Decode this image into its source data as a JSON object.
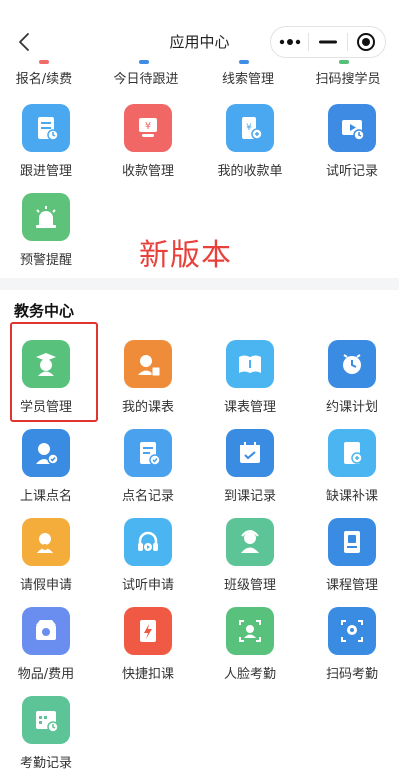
{
  "header": {
    "title": "应用中心"
  },
  "partial_row": {
    "items": [
      "报名/续费",
      "今日待跟进",
      "线索管理",
      "扫码搜学员"
    ],
    "stub_colors": [
      "#f26b6b",
      "#3f8de6",
      "#3f8de6",
      "#57c07a"
    ]
  },
  "sales": {
    "items": [
      {
        "label": "跟进管理",
        "icon": "follow-up-icon",
        "color": "#4aa8f0"
      },
      {
        "label": "收款管理",
        "icon": "payment-icon",
        "color": "#f06766"
      },
      {
        "label": "我的收款单",
        "icon": "receipt-icon",
        "color": "#4aa8f0"
      },
      {
        "label": "试听记录",
        "icon": "trial-record-icon",
        "color": "#3d8be3"
      },
      {
        "label": "预警提醒",
        "icon": "alarm-icon",
        "color": "#5fc27a"
      }
    ]
  },
  "annotation": {
    "text": "新版本"
  },
  "academic": {
    "title": "教务中心",
    "items": [
      {
        "label": "学员管理",
        "icon": "student-icon",
        "color": "#58c27d"
      },
      {
        "label": "我的课表",
        "icon": "my-schedule-icon",
        "color": "#ee8c3a"
      },
      {
        "label": "课表管理",
        "icon": "schedule-manage-icon",
        "color": "#4ab5f0"
      },
      {
        "label": "约课计划",
        "icon": "booking-plan-icon",
        "color": "#3a8be2"
      },
      {
        "label": "上课点名",
        "icon": "roll-call-icon",
        "color": "#3a8be2"
      },
      {
        "label": "点名记录",
        "icon": "roll-call-record-icon",
        "color": "#4aa2ef"
      },
      {
        "label": "到课记录",
        "icon": "attendance-record-icon",
        "color": "#3a8be2"
      },
      {
        "label": "缺课补课",
        "icon": "makeup-class-icon",
        "color": "#4ab5f0"
      },
      {
        "label": "请假申请",
        "icon": "leave-request-icon",
        "color": "#f4ac3b"
      },
      {
        "label": "试听申请",
        "icon": "trial-request-icon",
        "color": "#4ab5f0"
      },
      {
        "label": "班级管理",
        "icon": "class-manage-icon",
        "color": "#5cc497"
      },
      {
        "label": "课程管理",
        "icon": "course-manage-icon",
        "color": "#3a8be2"
      },
      {
        "label": "物品/费用",
        "icon": "goods-fee-icon",
        "color": "#6a8df0"
      },
      {
        "label": "快捷扣课",
        "icon": "quick-deduct-icon",
        "color": "#f05a44"
      },
      {
        "label": "人脸考勤",
        "icon": "face-attendance-icon",
        "color": "#58c27d"
      },
      {
        "label": "扫码考勤",
        "icon": "scan-attendance-icon",
        "color": "#3a8be2"
      },
      {
        "label": "考勤记录",
        "icon": "attendance-log-icon",
        "color": "#5cc497"
      }
    ]
  }
}
